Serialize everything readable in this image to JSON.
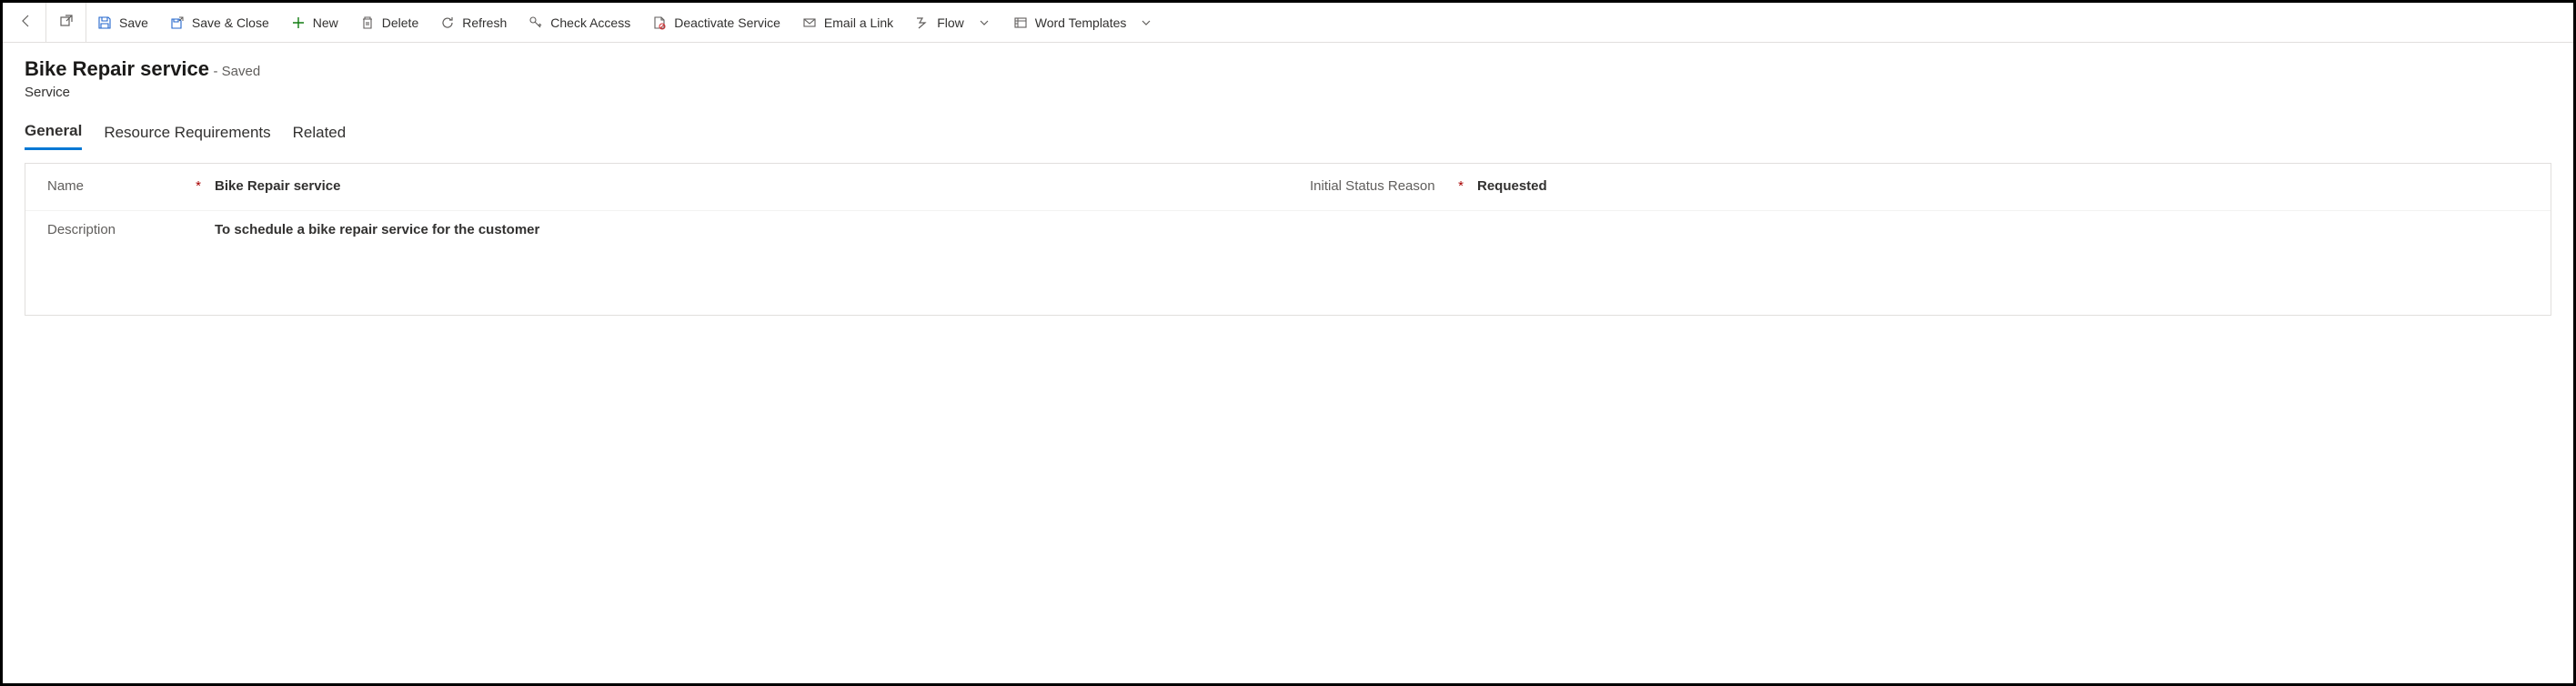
{
  "commandBar": {
    "save": "Save",
    "saveClose": "Save & Close",
    "new": "New",
    "delete": "Delete",
    "refresh": "Refresh",
    "checkAccess": "Check Access",
    "deactivate": "Deactivate Service",
    "emailLink": "Email a Link",
    "flow": "Flow",
    "wordTemplates": "Word Templates"
  },
  "header": {
    "title": "Bike Repair service",
    "savedBadge": "- Saved",
    "entity": "Service"
  },
  "tabs": {
    "general": "General",
    "resourceReq": "Resource Requirements",
    "related": "Related"
  },
  "fields": {
    "nameLabel": "Name",
    "nameValue": "Bike Repair service",
    "statusLabel": "Initial Status Reason",
    "statusValue": "Requested",
    "descLabel": "Description",
    "descValue": "To schedule a bike repair service for the customer"
  }
}
